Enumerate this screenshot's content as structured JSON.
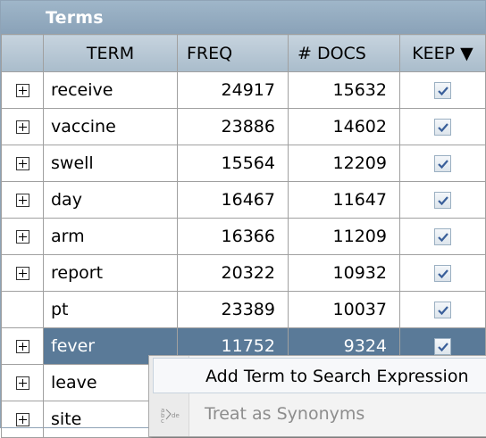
{
  "panel": {
    "title": "Terms"
  },
  "columns": {
    "term": "TERM",
    "freq": "FREQ",
    "docs": "# DOCS",
    "keep": "KEEP ▼"
  },
  "rows": [
    {
      "expandable": true,
      "term": "receive",
      "freq": "24917",
      "docs": "15632",
      "keep": true
    },
    {
      "expandable": true,
      "term": "vaccine",
      "freq": "23886",
      "docs": "14602",
      "keep": true
    },
    {
      "expandable": true,
      "term": "swell",
      "freq": "15564",
      "docs": "12209",
      "keep": true
    },
    {
      "expandable": true,
      "term": "day",
      "freq": "16467",
      "docs": "11647",
      "keep": true
    },
    {
      "expandable": true,
      "term": "arm",
      "freq": "16366",
      "docs": "11209",
      "keep": true
    },
    {
      "expandable": true,
      "term": "report",
      "freq": "20322",
      "docs": "10932",
      "keep": true
    },
    {
      "expandable": false,
      "term": "pt",
      "freq": "23389",
      "docs": "10037",
      "keep": true
    },
    {
      "expandable": true,
      "term": "fever",
      "freq": "11752",
      "docs": "9324",
      "keep": true,
      "selected": true
    },
    {
      "expandable": true,
      "term": "leave",
      "freq": "",
      "docs": "",
      "keep": null
    },
    {
      "expandable": true,
      "term": "site",
      "freq": "",
      "docs": "",
      "keep": null
    }
  ],
  "context_menu": {
    "items": [
      {
        "label": "Add Term to Search Expression",
        "enabled": true,
        "icon": ""
      },
      {
        "label": "Treat as Synonyms",
        "enabled": false,
        "icon": "synonyms-icon"
      }
    ]
  },
  "colors": {
    "title_bar": "#8aa2b8",
    "selected_row": "#5a7a98",
    "header": "#b5c6d4"
  }
}
